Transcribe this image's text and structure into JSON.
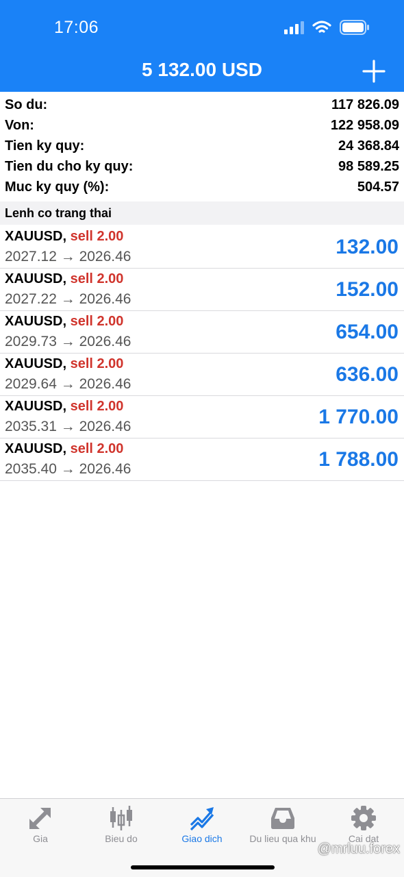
{
  "status_bar": {
    "time": "17:06"
  },
  "header": {
    "title": "5 132.00 USD"
  },
  "summary": [
    {
      "label": "So du:",
      "value": "117 826.09"
    },
    {
      "label": "Von:",
      "value": "122 958.09"
    },
    {
      "label": "Tien ky quy:",
      "value": "24 368.84"
    },
    {
      "label": "Tien du cho ky quy:",
      "value": "98 589.25"
    },
    {
      "label": "Muc ky quy (%):",
      "value": "504.57"
    }
  ],
  "section": {
    "title": "Lenh co trang thai"
  },
  "orders": [
    {
      "symbol": "XAUUSD,",
      "side": "sell 2.00",
      "prices": "2027.12 → 2026.46",
      "profit": "132.00"
    },
    {
      "symbol": "XAUUSD,",
      "side": "sell 2.00",
      "prices": "2027.22 → 2026.46",
      "profit": "152.00"
    },
    {
      "symbol": "XAUUSD,",
      "side": "sell 2.00",
      "prices": "2029.73 → 2026.46",
      "profit": "654.00"
    },
    {
      "symbol": "XAUUSD,",
      "side": "sell 2.00",
      "prices": "2029.64 → 2026.46",
      "profit": "636.00"
    },
    {
      "symbol": "XAUUSD,",
      "side": "sell 2.00",
      "prices": "2035.31 → 2026.46",
      "profit": "1 770.00"
    },
    {
      "symbol": "XAUUSD,",
      "side": "sell 2.00",
      "prices": "2035.40 → 2026.46",
      "profit": "1 788.00"
    }
  ],
  "tabs": [
    {
      "label": "Gia",
      "icon": "quotes-arrows-icon",
      "active": false
    },
    {
      "label": "Bieu do",
      "icon": "candlestick-chart-icon",
      "active": false
    },
    {
      "label": "Giao dich",
      "icon": "trade-trend-icon",
      "active": true
    },
    {
      "label": "Du lieu qua khu",
      "icon": "history-inbox-icon",
      "active": false
    },
    {
      "label": "Cai dat",
      "icon": "gear-icon",
      "active": false
    }
  ],
  "watermark": "@mrluu.forex",
  "colors": {
    "header_bg": "#1a82f7",
    "profit_blue": "#1a78e6",
    "sell_red": "#d0342c",
    "tab_inactive": "#8e8e93"
  }
}
